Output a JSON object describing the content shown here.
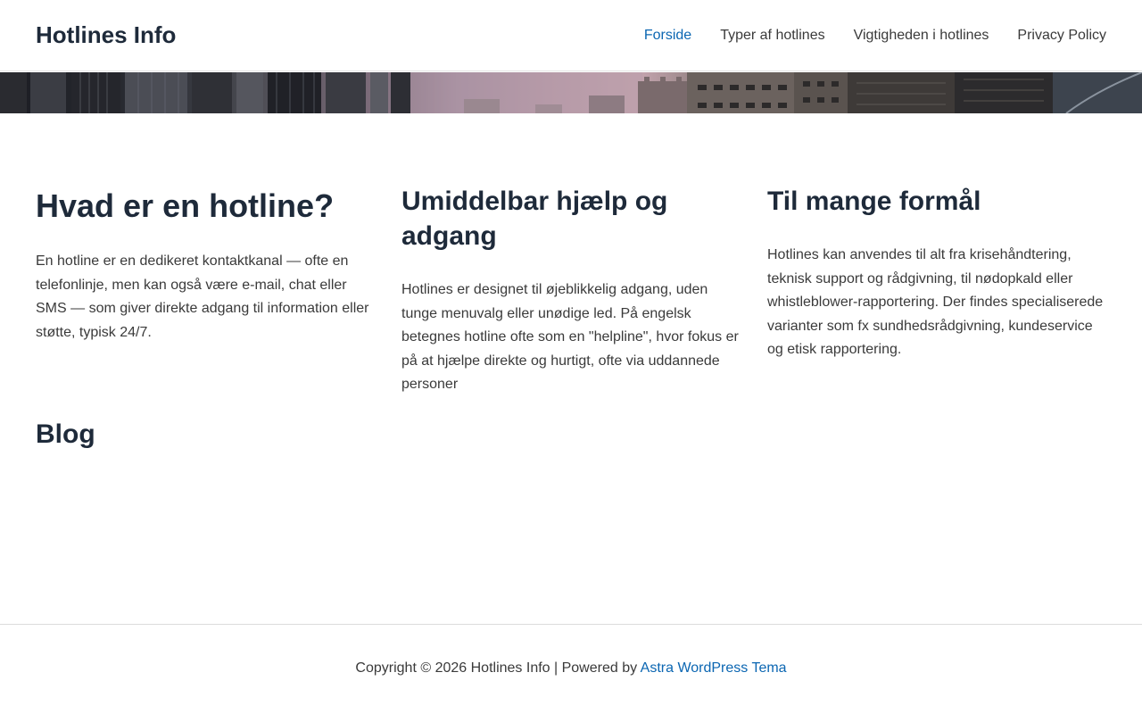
{
  "header": {
    "site_title": "Hotlines Info",
    "nav": [
      {
        "label": "Forside",
        "active": true
      },
      {
        "label": "Typer af hotlines",
        "active": false
      },
      {
        "label": "Vigtigheden i hotlines",
        "active": false
      },
      {
        "label": "Privacy Policy",
        "active": false
      }
    ]
  },
  "colors": {
    "heading": "#1e2a3a",
    "text": "#3a3a3a",
    "link_active": "#0b66b2",
    "border": "#e2e2e2"
  },
  "main": {
    "columns": [
      {
        "heading": "Hvad er en hotline?",
        "text": "En hotline er en dedikeret kontaktkanal — ofte en telefonlinje, men kan også være e-mail, chat eller SMS — som giver direkte adgang til information eller støtte, typisk 24/7."
      },
      {
        "heading": "Umiddelbar hjælp og adgang",
        "text": "Hotlines er designet til øjeblikkelig adgang, uden tunge menuvalg eller unødige led. På engelsk betegnes hotline ofte som en \"helpline\", hvor fokus er på at hjælpe direkte og hurtigt, ofte via uddannede personer"
      },
      {
        "heading": "Til mange formål",
        "text": "Hotlines kan anvendes til alt fra krisehåndtering, teknisk support og rådgivning, til nødopkald eller whistleblower-rapportering. Der findes specialiserede varianter som fx sundhedsrådgivning, kundeservice og etisk rapportering."
      }
    ],
    "blog_heading": "Blog"
  },
  "footer": {
    "copyright_prefix": "Copyright © 2026 Hotlines Info | Powered by ",
    "link_label": "Astra WordPress Tema"
  }
}
